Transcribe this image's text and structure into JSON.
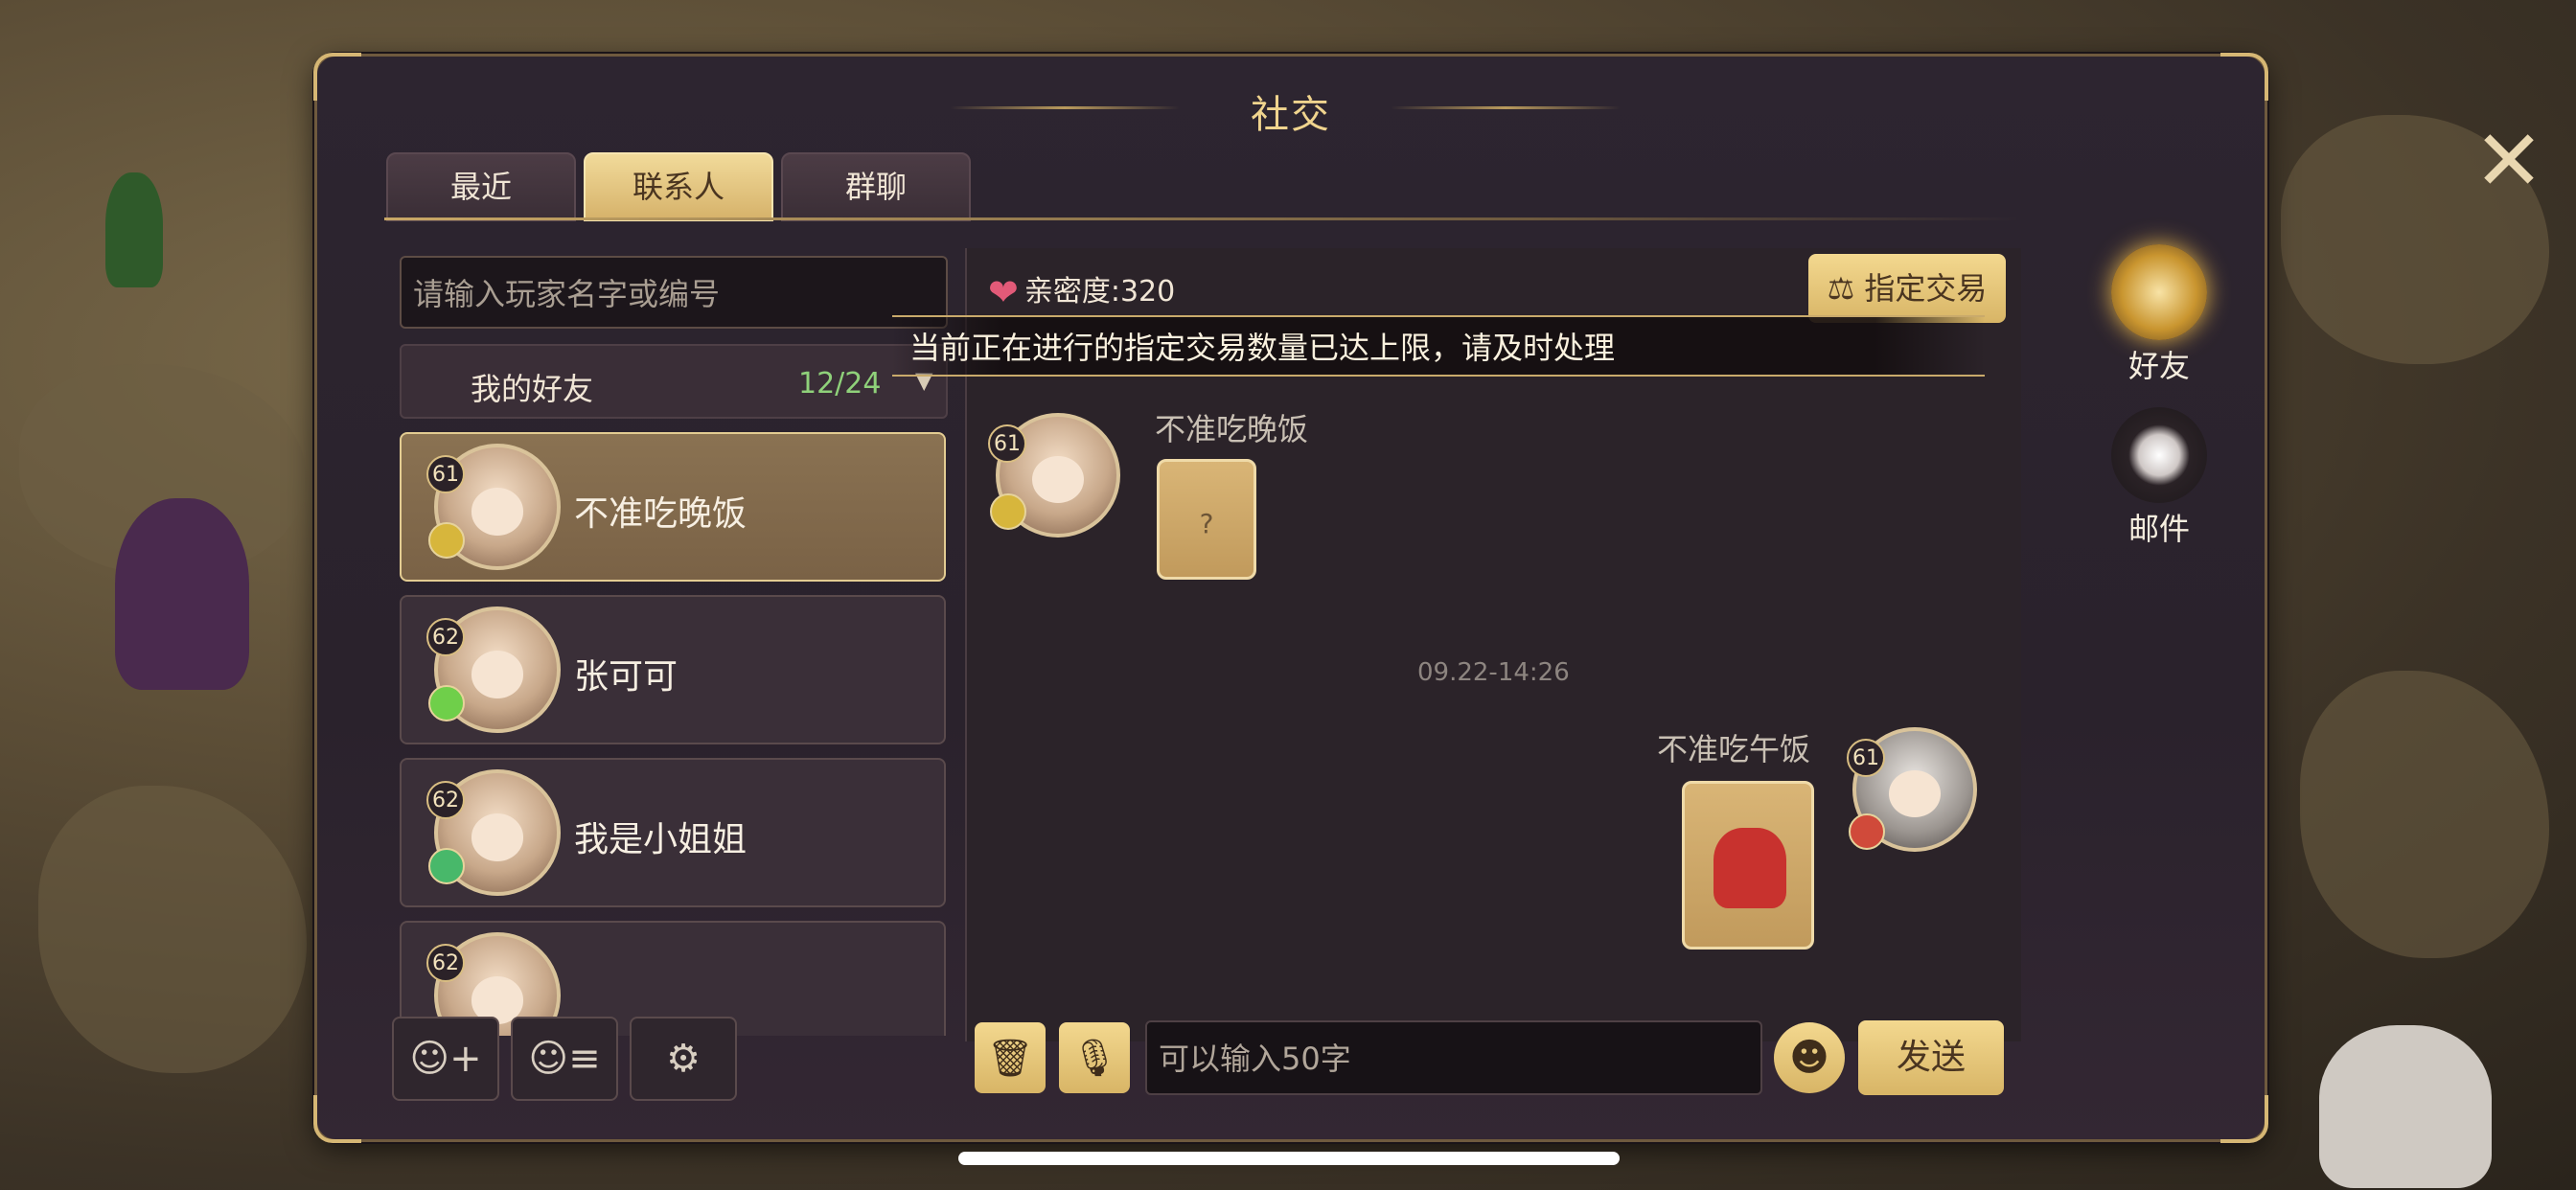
{
  "window": {
    "title": "社交",
    "close_glyph": "✕"
  },
  "tabs": [
    {
      "label": "最近",
      "active": false
    },
    {
      "label": "联系人",
      "active": true
    },
    {
      "label": "群聊",
      "active": false
    }
  ],
  "search": {
    "placeholder": "请输入玩家名字或编号"
  },
  "friend_group": {
    "label": "我的好友",
    "count": "12/24",
    "arrow": "▼"
  },
  "friends": [
    {
      "level": "61",
      "name": "不准吃晚饭",
      "selected": true,
      "element_color": "#d7b63c"
    },
    {
      "level": "62",
      "name": "张可可",
      "selected": false,
      "element_color": "#6fcf4a"
    },
    {
      "level": "62",
      "name": "我是小姐姐",
      "selected": false,
      "element_color": "#48b86a"
    },
    {
      "level": "62",
      "name": "",
      "selected": false,
      "element_color": "#8a8a8a"
    }
  ],
  "chat": {
    "intimacy_label": "亲密度:320",
    "heart_glyph": "❤",
    "trade_button": "指定交易",
    "trade_icon": "⚖",
    "notice": "当前正在进行的指定交易数量已达上限，请及时处理",
    "messages": [
      {
        "sender": "不准吃晚饭",
        "level": "61",
        "side": "left",
        "content_icon": "?"
      },
      {
        "sender": "不准吃午饭",
        "level": "61",
        "side": "right",
        "content_icon": "little-red-hood-sticker"
      }
    ],
    "timestamp": "09.22-14:26",
    "input_placeholder": "可以输入50字",
    "send_button": "发送"
  },
  "bottom_left_icons": [
    "add-friend-icon",
    "friend-list-icon",
    "settings-icon"
  ],
  "sidebar": [
    {
      "label": "好友",
      "icon": "friend-avatar-icon",
      "active": true
    },
    {
      "label": "邮件",
      "icon": "mail-feather-icon",
      "active": false
    }
  ],
  "colors": {
    "accent_gold": "#d8b566",
    "count_green": "#8fd17a",
    "heart_pink": "#e25a78"
  }
}
